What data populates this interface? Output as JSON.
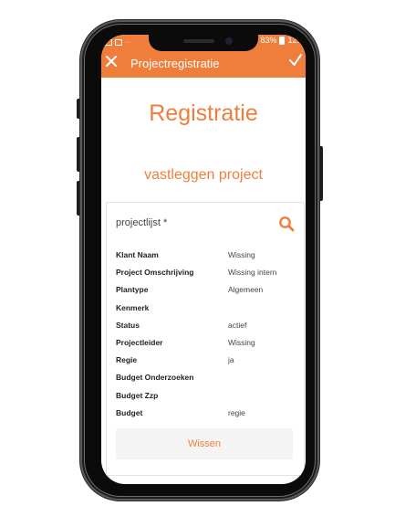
{
  "status_bar": {
    "battery_text": "83%",
    "time": "12:5"
  },
  "appbar": {
    "title": "Projectregistratie",
    "close_icon": "close-icon",
    "confirm_icon": "check-icon"
  },
  "heading": "Registratie",
  "subheading": "vastleggen project",
  "search": {
    "label": "projectlijst *",
    "icon": "search-icon"
  },
  "details": [
    {
      "key": "Klant Naam",
      "value": "Wissing"
    },
    {
      "key": "Project Omschrijving",
      "value": "Wissing intern"
    },
    {
      "key": "Plantype",
      "value": "Algemeen"
    },
    {
      "key": "Kenmerk",
      "value": ""
    },
    {
      "key": "Status",
      "value": "actief"
    },
    {
      "key": "Projectleider",
      "value": "Wissing"
    },
    {
      "key": "Regie",
      "value": "ja"
    },
    {
      "key": "Budget Onderzoeken",
      "value": ""
    },
    {
      "key": "Budget Zzp",
      "value": ""
    },
    {
      "key": "Budget",
      "value": "regie"
    }
  ],
  "clear_button": "Wissen",
  "colors": {
    "accent": "#ef7e3c",
    "frame": "#1d1d1d"
  }
}
